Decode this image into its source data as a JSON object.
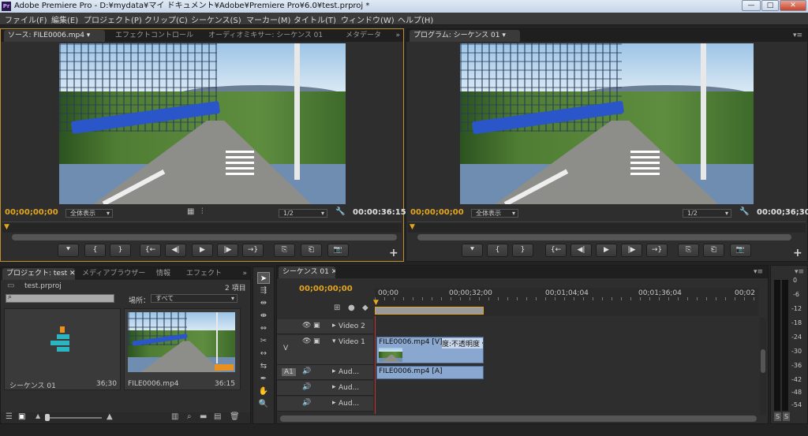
{
  "window": {
    "title": "Adobe Premiere Pro - D:¥mydata¥マイ ドキュメント¥Adobe¥Premiere Pro¥6.0¥test.prproj *",
    "app_icon": "Pr",
    "minimize": "—",
    "maximize": "□",
    "close": "✕"
  },
  "menu": [
    "ファイル(F)",
    "編集(E)",
    "プロジェクト(P)",
    "クリップ(C)",
    "シーケンス(S)",
    "マーカー(M)",
    "タイトル(T)",
    "ウィンドウ(W)",
    "ヘルプ(H)"
  ],
  "source_panel": {
    "tabs": [
      "ソース: FILE0006.mp4 ▾",
      "エフェクトコントロール",
      "オーディオミキサー: シーケンス 01",
      "メタデータ"
    ],
    "timecode_current": "00;00;00;00",
    "zoom": "全体表示",
    "resolution": "1/2",
    "timecode_duration": "00:00:36:15",
    "controls": [
      "⯆",
      "{",
      "}",
      "{←",
      "◀|",
      "▶",
      "|▶",
      "→}",
      "⎘",
      "⎗",
      "📷"
    ],
    "add": "+"
  },
  "program_panel": {
    "tab": "プログラム: シーケンス 01 ▾",
    "timecode_current": "00;00;00;00",
    "zoom": "全体表示",
    "resolution": "1/2",
    "timecode_duration": "00:00;36;30",
    "controls": [
      "⯆",
      "{",
      "}",
      "{←",
      "◀|",
      "▶",
      "|▶",
      "→}",
      "⎘",
      "⎗",
      "📷"
    ],
    "add": "+"
  },
  "project_panel": {
    "tabs": [
      "プロジェクト: test ✕",
      "メディアブラウザー",
      "情報",
      "エフェクト"
    ],
    "project_file": "test.prproj",
    "item_count": "2 項目",
    "search_placeholder": "",
    "location_label": "場所：",
    "location_value": "すべて",
    "items": [
      {
        "name": "シーケンス 01",
        "duration": "36;30"
      },
      {
        "name": "FILE0006.mp4",
        "duration": "36:15"
      }
    ]
  },
  "timeline_panel": {
    "tab": "シーケンス 01 ✕",
    "timecode": "00;00;00;00",
    "ruler_labels": [
      "00;00",
      "00;00;32;00",
      "00;01;04;04",
      "00;01;36;04",
      "00;02"
    ],
    "tracks": [
      {
        "name": "Video 2",
        "kind": "video"
      },
      {
        "name": "Video 1",
        "kind": "video",
        "target": "V"
      },
      {
        "name": "Aud...",
        "kind": "audio",
        "target": "A1"
      },
      {
        "name": "Aud...",
        "kind": "audio"
      },
      {
        "name": "Aud...",
        "kind": "audio"
      }
    ],
    "video_clip": {
      "name": "FILE0006.mp4 [V]",
      "effect": "度:不透明度 ▾"
    },
    "audio_clip": {
      "name": "FILE0006.mp4 [A]"
    }
  },
  "audio_meter": {
    "labels": [
      "0",
      "-6",
      "-12",
      "-18",
      "-24",
      "-30",
      "-36",
      "-42",
      "-48",
      "-54"
    ],
    "solo": [
      "S",
      "S"
    ]
  },
  "colors": {
    "accent_timecode": "#e3a520",
    "panel_bg": "#2e2e2e",
    "clip_blue": "#8aa7cf"
  }
}
